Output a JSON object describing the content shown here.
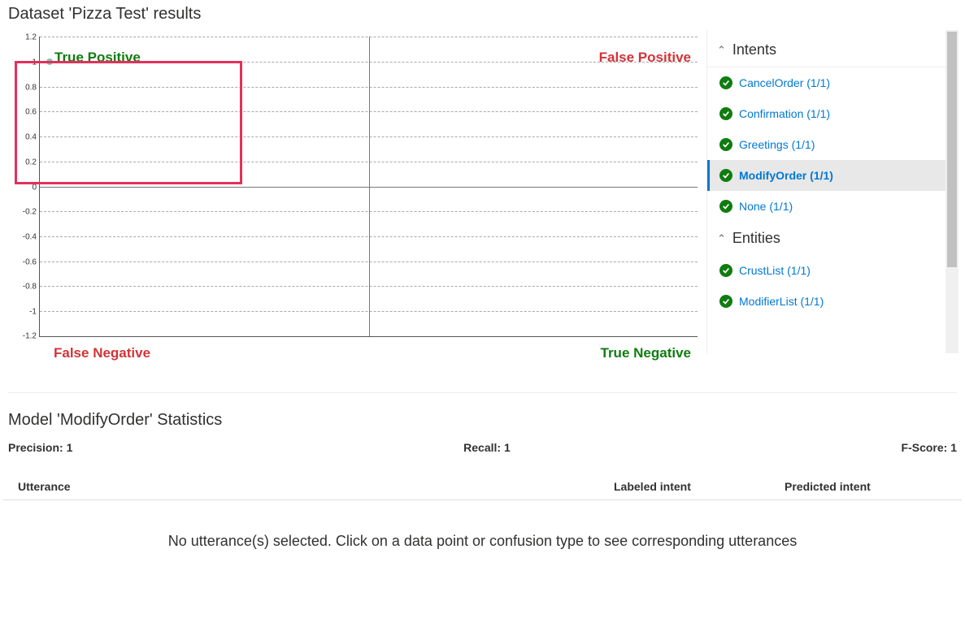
{
  "page_title": "Dataset 'Pizza Test' results",
  "chart_data": {
    "type": "scatter",
    "quadrants": {
      "true_positive": "True Positive",
      "false_positive": "False Positive",
      "false_negative": "False Negative",
      "true_negative": "True Negative"
    },
    "ylim": [
      -1.2,
      1.2
    ],
    "y_ticks": [
      "1.2",
      "1",
      "0.8",
      "0.6",
      "0.4",
      "0.2",
      "0",
      "-0.2",
      "-0.4",
      "-0.6",
      "-0.8",
      "-1",
      "-1.2"
    ],
    "points": [
      {
        "x_rel": 0.01,
        "y": 1.0
      }
    ]
  },
  "sidebar": {
    "sections": [
      {
        "title": "Intents",
        "items": [
          {
            "label": "CancelOrder (1/1)",
            "status": "ok",
            "selected": false
          },
          {
            "label": "Confirmation (1/1)",
            "status": "ok",
            "selected": false
          },
          {
            "label": "Greetings (1/1)",
            "status": "ok",
            "selected": false
          },
          {
            "label": "ModifyOrder (1/1)",
            "status": "ok",
            "selected": true
          },
          {
            "label": "None (1/1)",
            "status": "ok",
            "selected": false
          }
        ]
      },
      {
        "title": "Entities",
        "items": [
          {
            "label": "CrustList (1/1)",
            "status": "ok",
            "selected": false
          },
          {
            "label": "ModifierList (1/1)",
            "status": "ok",
            "selected": false
          }
        ]
      }
    ]
  },
  "stats": {
    "title": "Model 'ModifyOrder' Statistics",
    "precision_label": "Precision: 1",
    "recall_label": "Recall: 1",
    "fscore_label": "F-Score: 1"
  },
  "table": {
    "headers": {
      "utterance": "Utterance",
      "labeled": "Labeled intent",
      "predicted": "Predicted intent"
    },
    "empty_msg": "No utterance(s) selected. Click on a data point or confusion type to see corresponding utterances"
  }
}
